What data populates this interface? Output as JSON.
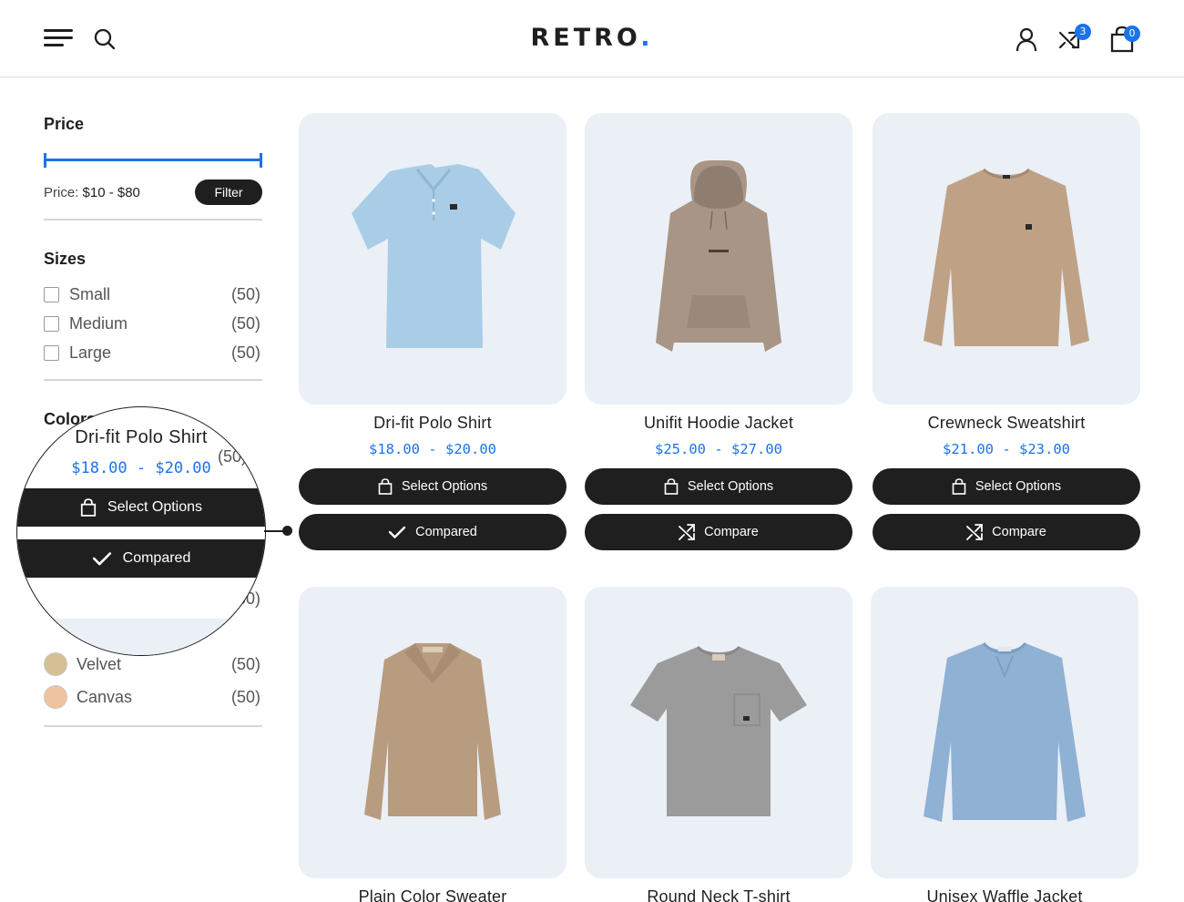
{
  "header": {
    "logo_text": "RETRO",
    "logo_dot": ".",
    "compare_count": "3",
    "cart_count": "0"
  },
  "sidebar": {
    "price": {
      "title": "Price",
      "label": "Price:",
      "range": "$10 - $80",
      "filter_button": "Filter"
    },
    "sizes": {
      "title": "Sizes",
      "items": [
        {
          "label": "Small",
          "count": "(50)"
        },
        {
          "label": "Medium",
          "count": "(50)"
        },
        {
          "label": "Large",
          "count": "(50)"
        }
      ]
    },
    "colors": {
      "title": "Colors",
      "items": [
        {
          "label": "",
          "count": "(50)",
          "swatch": "#7fa89a"
        },
        {
          "label": "",
          "count": "(50)",
          "swatch": "#8fb7a3"
        },
        {
          "label": "Velvet",
          "count": "(50)",
          "swatch": "#c9a977"
        },
        {
          "label": "Canvas",
          "count": "(50)",
          "swatch": "#e9b18a"
        }
      ]
    }
  },
  "products": [
    {
      "name": "Dri-fit Polo Shirt",
      "price": "$18.00 - $20.00",
      "select_label": "Select Options",
      "compare_label": "Compared",
      "compared": true,
      "color": "#a9cde6"
    },
    {
      "name": "Unifit Hoodie Jacket",
      "price": "$25.00 - $27.00",
      "select_label": "Select Options",
      "compare_label": "Compare",
      "compared": false,
      "color": "#a89585"
    },
    {
      "name": "Crewneck Sweatshirt",
      "price": "$21.00 - $23.00",
      "select_label": "Select Options",
      "compare_label": "Compare",
      "compared": false,
      "color": "#bfa286"
    },
    {
      "name": "Plain Color Sweater",
      "price": "",
      "color": "#b89c80"
    },
    {
      "name": "Round Neck T-shirt",
      "price": "",
      "color": "#9b9b9b"
    },
    {
      "name": "Unisex Waffle Jacket",
      "price": "",
      "color": "#8fb1d4"
    }
  ],
  "magnifier": {
    "name": "Dri-fit Polo Shirt",
    "price": "$18.00 - $20.00",
    "select_label": "Select Options",
    "compare_label": "Compared",
    "behind_count": "(50)"
  }
}
